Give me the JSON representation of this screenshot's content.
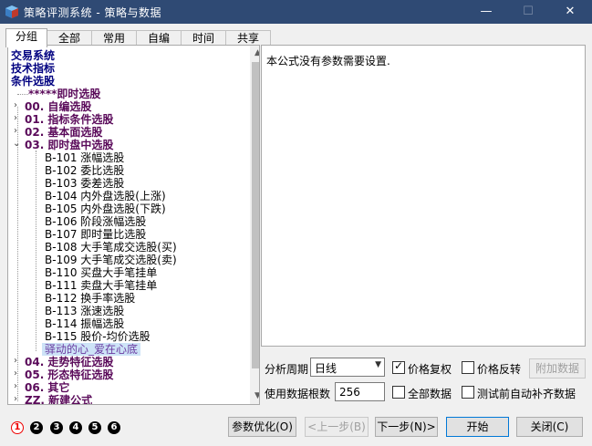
{
  "window": {
    "title": "策略评测系统 - 策略与数据",
    "min_glyph": "—",
    "max_glyph": "☐",
    "close_glyph": "✕"
  },
  "tabs": [
    {
      "label": "分组",
      "active": true
    },
    {
      "label": "全部"
    },
    {
      "label": "常用"
    },
    {
      "label": "自编"
    },
    {
      "label": "时间"
    },
    {
      "label": "共享"
    }
  ],
  "tree": {
    "roots": [
      "交易系统",
      "技术指标",
      "条件选股"
    ],
    "star_item": "*****即时选股",
    "categories_top": [
      "00. 自编选股",
      "01. 指标条件选股",
      "02. 基本面选股",
      "03. 即时盘中选股"
    ],
    "leaves": [
      "B-101 涨幅选股",
      "B-102 委比选股",
      "B-103 委差选股",
      "B-104 内外盘选股(上涨)",
      "B-105 内外盘选股(下跌)",
      "B-106 阶段涨幅选股",
      "B-107 即时量比选股",
      "B-108 大手笔成交选股(买)",
      "B-109 大手笔成交选股(卖)",
      "B-110 买盘大手笔挂单",
      "B-111 卖盘大手笔挂单",
      "B-112 换手率选股",
      "B-113 涨速选股",
      "B-114 振幅选股",
      "B-115 股价-均价选股"
    ],
    "selected_leaf": "驿动的心_爱在心底",
    "categories_bottom": [
      "04. 走势特征选股",
      "05. 形态特征选股",
      "06. 其它",
      "ZZ. 新建公式"
    ],
    "collapsed_glyph": "›",
    "expanded_glyph": "⌄",
    "scroll_up_glyph": "▲",
    "scroll_down_glyph": "▼"
  },
  "info": {
    "text": "本公式没有参数需要设置."
  },
  "controls": {
    "period_label": "分析周期",
    "period_value": "日线",
    "bars_label": "使用数据根数",
    "bars_value": "256",
    "dropdown_glyph": "▼",
    "check_glyph": "✓",
    "chk_price_adjust": {
      "label": "价格复权",
      "checked": true
    },
    "chk_price_reverse": {
      "label": "价格反转",
      "checked": false
    },
    "chk_all_data": {
      "label": "全部数据",
      "checked": false
    },
    "chk_auto_fill": {
      "label": "测试前自动补齐数据",
      "checked": false
    },
    "add_data_button": "附加数据"
  },
  "footer": {
    "steps": [
      "1",
      "2",
      "3",
      "4",
      "5",
      "6"
    ],
    "param_opt": "参数优化(O)",
    "prev": "<上一步(B)",
    "next": "下一步(N)>",
    "start": "开始",
    "close": "关闭(C)"
  },
  "colors": {
    "titlebar": "#2f4a74",
    "category": "#5a0a5a",
    "root": "#000080",
    "selected_bg": "#cde3f7",
    "step_active": "#e00000"
  }
}
